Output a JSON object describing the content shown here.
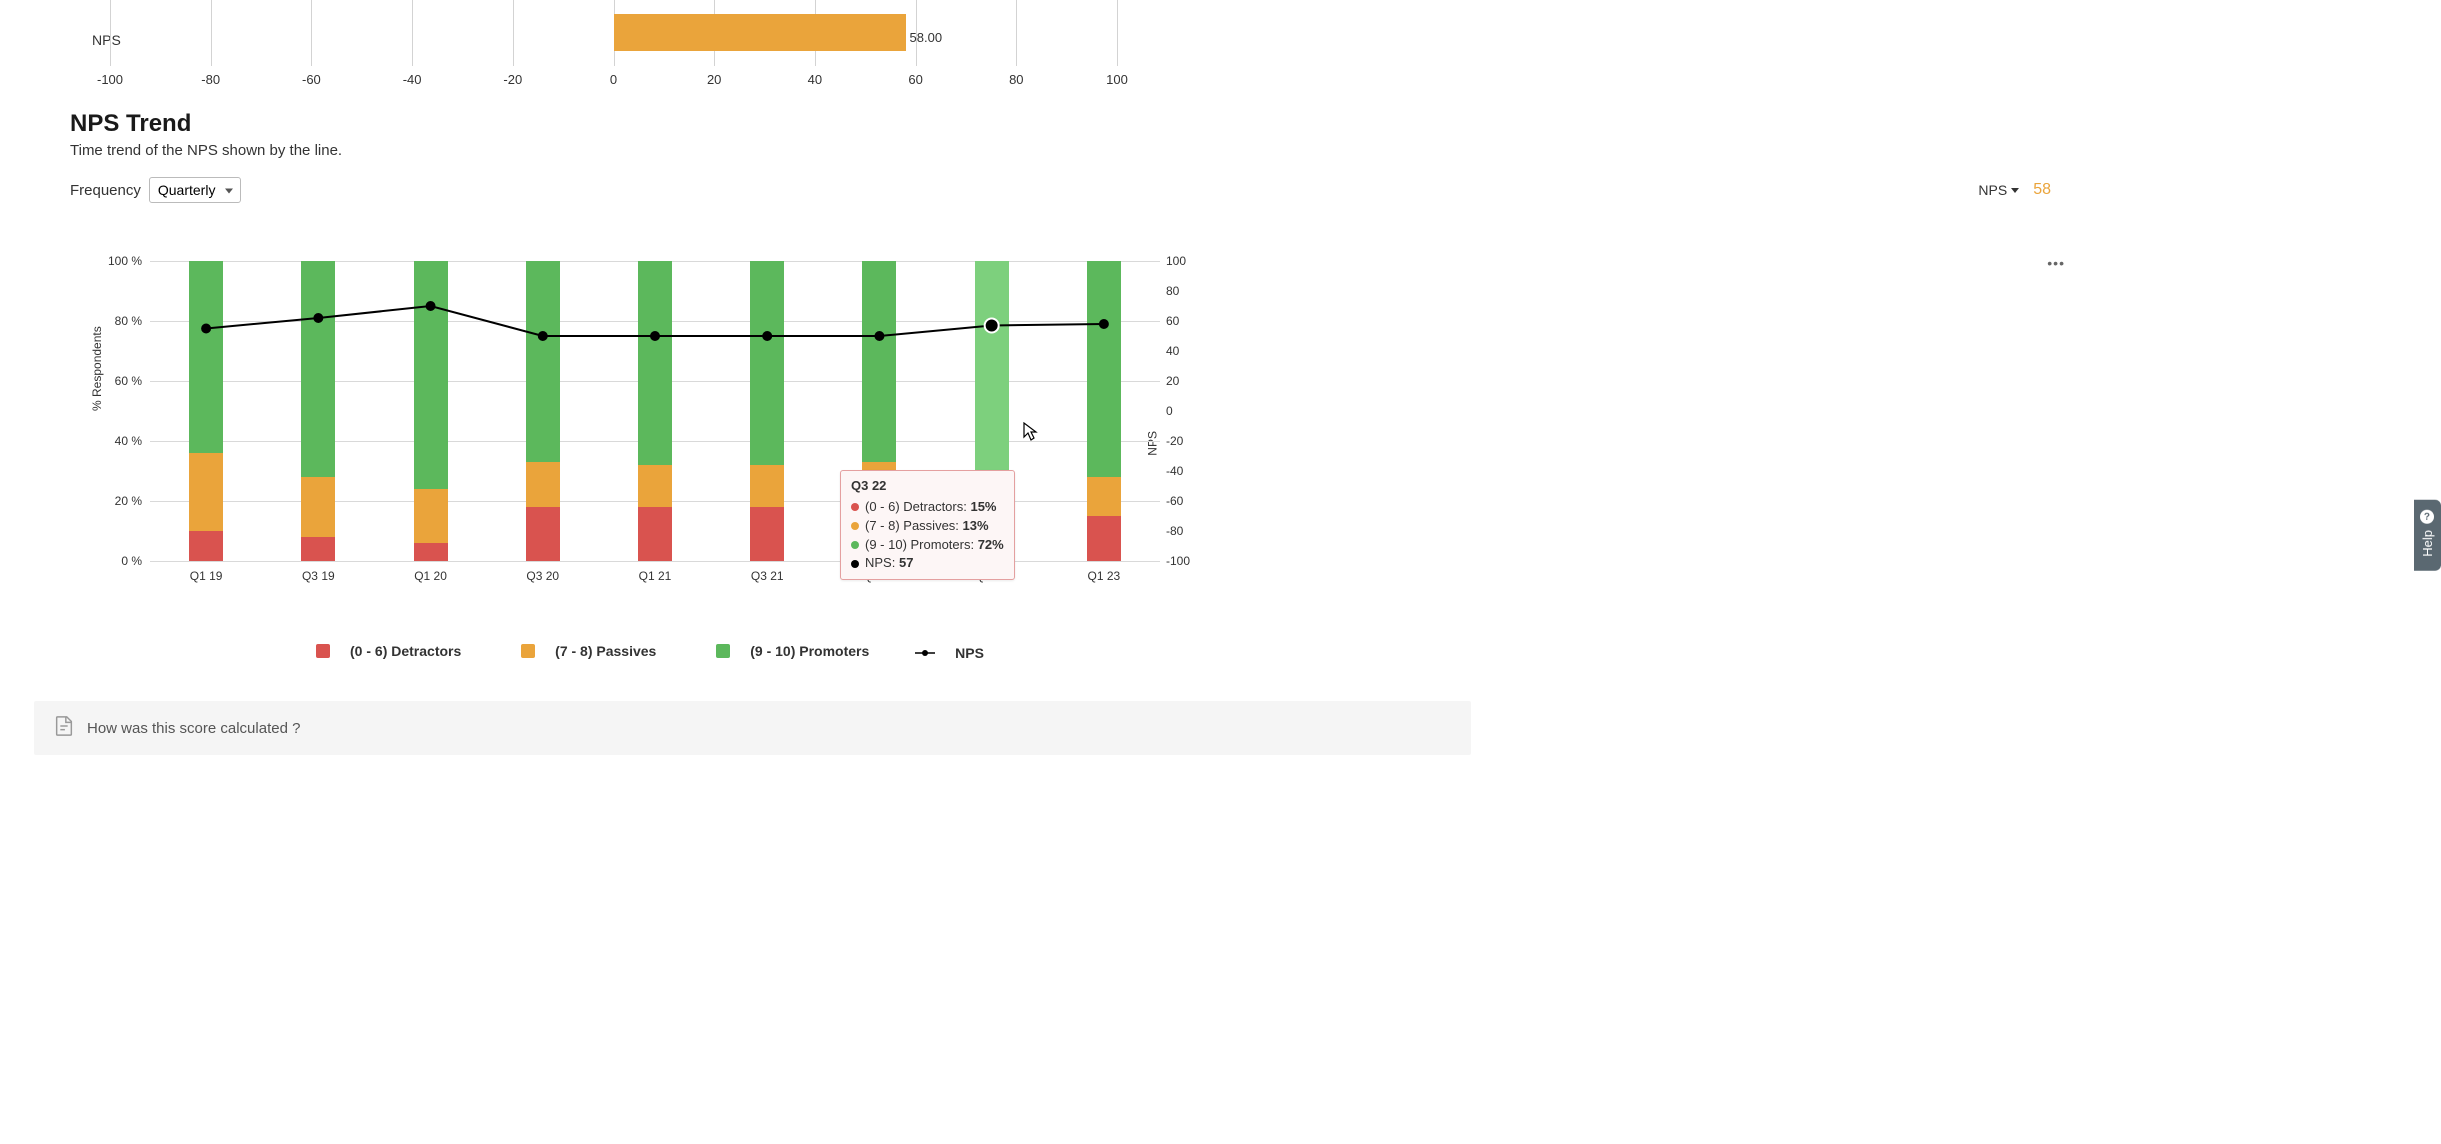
{
  "nps_bar": {
    "label": "NPS",
    "value": 58.0,
    "value_label": "58.00",
    "ticks": [
      "-100",
      "-80",
      "-60",
      "-40",
      "-20",
      "0",
      "20",
      "40",
      "60",
      "80",
      "100"
    ],
    "tick_values": [
      -100,
      -80,
      -60,
      -40,
      -20,
      0,
      20,
      40,
      60,
      80,
      100
    ]
  },
  "section": {
    "title": "NPS Trend",
    "subtitle": "Time trend of the NPS shown by the line."
  },
  "controls": {
    "freq_label": "Frequency",
    "freq_value": "Quarterly",
    "nps_dd_label": "NPS",
    "nps_current": "58"
  },
  "trend": {
    "left_axis_title": "% Respondents",
    "right_axis_title": "NPS",
    "left_ticks": [
      "0 %",
      "20 %",
      "40 %",
      "60 %",
      "80 %",
      "100 %"
    ],
    "right_ticks": [
      "-100",
      "-80",
      "-60",
      "-40",
      "-20",
      "0",
      "20",
      "40",
      "60",
      "80",
      "100"
    ],
    "categories": [
      "Q1 19",
      "Q3 19",
      "Q1 20",
      "Q3 20",
      "Q1 21",
      "Q3 21",
      "Q1 22",
      "Q3 22",
      "Q1 23"
    ]
  },
  "tooltip": {
    "title": "Q3 22",
    "det_label": "(0 - 6) Detractors: ",
    "det_val": "15%",
    "pas_label": "(7 - 8) Passives: ",
    "pas_val": "13%",
    "pro_label": "(9 - 10) Promoters: ",
    "pro_val": "72%",
    "nps_label": "NPS: ",
    "nps_val": "57"
  },
  "legend": {
    "det": "(0 - 6) Detractors",
    "pas": "(7 - 8) Passives",
    "pro": "(9 - 10) Promoters",
    "nps": "NPS"
  },
  "footer": {
    "text": "How was this score calculated ?"
  },
  "help_tab": "Help",
  "colors": {
    "detractors": "#d9534f",
    "passives": "#eaa43b",
    "promoters": "#5cb85c",
    "promoters_highlight": "#7dd07d",
    "nps_line": "#000000",
    "nps_value": "#eaa43b"
  },
  "chart_data": [
    {
      "type": "bar",
      "name": "nps_bar_top",
      "categories": [
        "NPS"
      ],
      "values": [
        58.0
      ],
      "xlabel": "",
      "ylabel": "",
      "xlim": [
        -100,
        100
      ]
    },
    {
      "type": "bar",
      "name": "nps_trend_stacked",
      "categories": [
        "Q1 19",
        "Q3 19",
        "Q1 20",
        "Q3 20",
        "Q1 21",
        "Q3 21",
        "Q1 22",
        "Q3 22",
        "Q1 23"
      ],
      "series": [
        {
          "name": "(0 - 6) Detractors",
          "values": [
            10,
            8,
            6,
            18,
            18,
            18,
            18,
            15,
            15
          ]
        },
        {
          "name": "(7 - 8) Passives",
          "values": [
            26,
            20,
            18,
            15,
            14,
            14,
            15,
            13,
            13
          ]
        },
        {
          "name": "(9 - 10) Promoters",
          "values": [
            64,
            72,
            76,
            67,
            68,
            68,
            67,
            72,
            72
          ]
        }
      ],
      "ylabel": "% Respondents",
      "ylim": [
        0,
        100
      ],
      "stacked": true
    },
    {
      "type": "line",
      "name": "nps_line",
      "x": [
        "Q1 19",
        "Q3 19",
        "Q1 20",
        "Q3 20",
        "Q1 21",
        "Q3 21",
        "Q1 22",
        "Q3 22",
        "Q1 23"
      ],
      "values": [
        55,
        62,
        70,
        50,
        50,
        50,
        50,
        57,
        58
      ],
      "ylabel": "NPS",
      "ylim": [
        -100,
        100
      ],
      "right_axis": true
    }
  ]
}
